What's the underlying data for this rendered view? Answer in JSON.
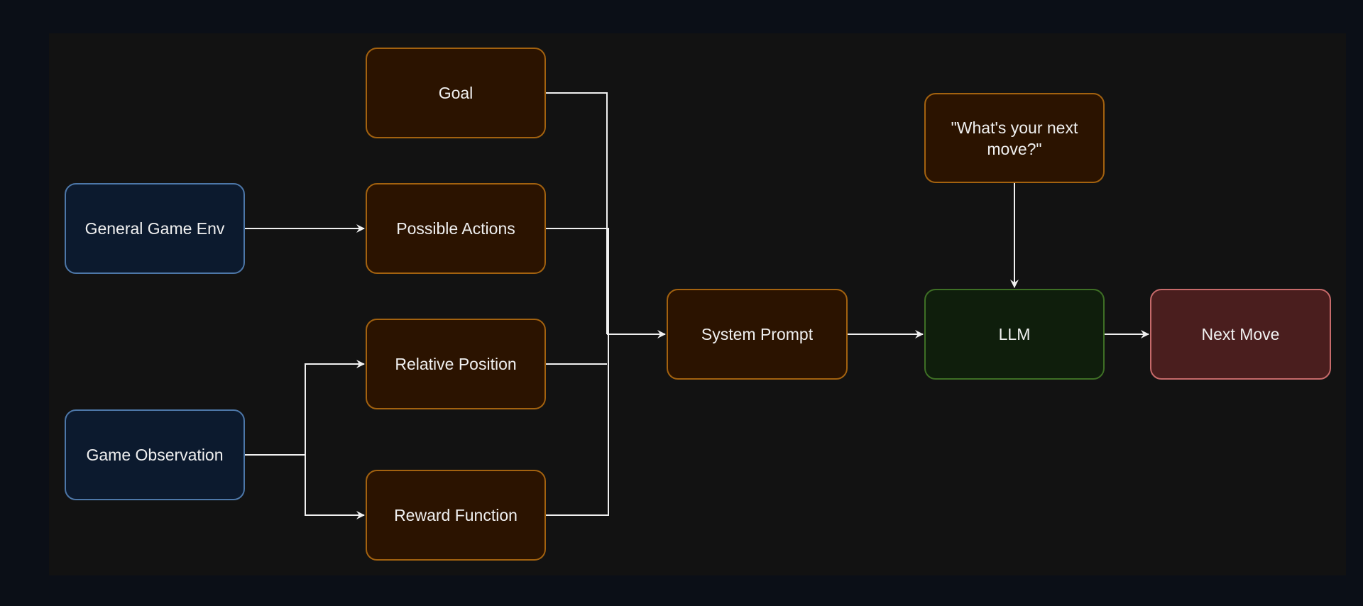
{
  "nodes": {
    "goal": "Goal",
    "possible_actions": "Possible Actions",
    "relative_position": "Relative Position",
    "reward_function": "Reward Function",
    "general_game_env": "General Game Env",
    "game_observation": "Game Observation",
    "system_prompt": "System Prompt",
    "question": "\"What's your next move?\"",
    "llm": "LLM",
    "next_move": "Next Move"
  },
  "colors": {
    "background": "#0b0f17",
    "canvas": "#121212",
    "prompt_component": "#2b1300",
    "input_source": "#0c1a2e",
    "model": "#0f1e0c",
    "output": "#4a1e1e",
    "edge": "#f0f0f0"
  },
  "edges": [
    [
      "general_game_env",
      "possible_actions"
    ],
    [
      "game_observation",
      "relative_position"
    ],
    [
      "game_observation",
      "reward_function"
    ],
    [
      "goal",
      "system_prompt"
    ],
    [
      "possible_actions",
      "system_prompt"
    ],
    [
      "relative_position",
      "system_prompt"
    ],
    [
      "reward_function",
      "system_prompt"
    ],
    [
      "system_prompt",
      "llm"
    ],
    [
      "question",
      "llm"
    ],
    [
      "llm",
      "next_move"
    ]
  ]
}
